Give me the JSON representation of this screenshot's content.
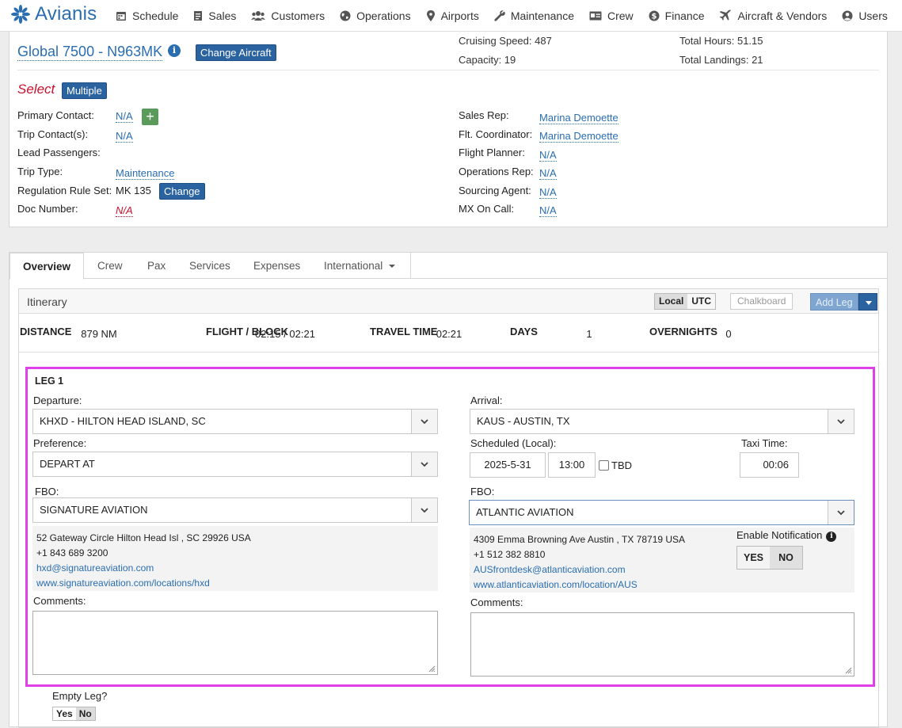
{
  "nav": {
    "logo": "Avianis",
    "items": [
      {
        "label": "Schedule",
        "icon": "calendar-icon"
      },
      {
        "label": "Sales",
        "icon": "receipt-icon"
      },
      {
        "label": "Customers",
        "icon": "users-icon"
      },
      {
        "label": "Operations",
        "icon": "globe-icon"
      },
      {
        "label": "Airports",
        "icon": "map-pin-icon"
      },
      {
        "label": "Maintenance",
        "icon": "wrench-icon"
      },
      {
        "label": "Crew",
        "icon": "id-card-icon"
      },
      {
        "label": "Finance",
        "icon": "dollar-icon"
      },
      {
        "label": "Aircraft & Vendors",
        "icon": "plane-icon"
      },
      {
        "label": "Users",
        "icon": "user-icon"
      }
    ]
  },
  "header": {
    "aircraft": "Global 7500 - N963MK",
    "change_aircraft": "Change Aircraft",
    "cruising_speed": "Cruising Speed: 487",
    "capacity": "Capacity: 19",
    "total_hours": "Total Hours: 51.15",
    "total_landings": "Total Landings: 21",
    "select_label": "Select",
    "multiple": "Multiple",
    "left_fields": [
      {
        "label": "Primary Contact:",
        "value": "N/A"
      },
      {
        "label": "Trip Contact(s):",
        "value": "N/A"
      },
      {
        "label": "Lead Passengers:",
        "value": ""
      },
      {
        "label": "Trip Type:",
        "value": "Maintenance"
      },
      {
        "label": "Regulation Rule Set:",
        "value": "MK 135"
      },
      {
        "label": "Doc Number:",
        "value": "N/A"
      }
    ],
    "change_rule": "Change",
    "right_fields": [
      {
        "label": "Sales Rep:",
        "value": "Marina Demoette"
      },
      {
        "label": "Flt. Coordinator:",
        "value": "Marina Demoette"
      },
      {
        "label": "Flight Planner:",
        "value": "N/A"
      },
      {
        "label": "Operations Rep:",
        "value": "N/A"
      },
      {
        "label": "Sourcing Agent:",
        "value": "N/A"
      },
      {
        "label": "MX On Call:",
        "value": "N/A"
      }
    ]
  },
  "tabs": [
    "Overview",
    "Crew",
    "Pax",
    "Services",
    "Expenses",
    "International"
  ],
  "itinerary": {
    "title": "Itinerary",
    "local": "Local",
    "utc": "UTC",
    "chalkboard": "Chalkboard",
    "add_leg": "Add Leg",
    "stats": [
      {
        "label": "DISTANCE",
        "value": "879 NM"
      },
      {
        "label": "FLIGHT / BLOCK",
        "value": "02:15 / 02:21"
      },
      {
        "label": "TRAVEL TIME",
        "value": "02:21"
      },
      {
        "label": "DAYS",
        "value": "1"
      },
      {
        "label": "OVERNIGHTS",
        "value": "0"
      }
    ]
  },
  "leg": {
    "title": "LEG 1",
    "departure_label": "Departure:",
    "departure": "KHXD - HILTON HEAD ISLAND, SC",
    "preference_label": "Preference:",
    "preference": "DEPART AT",
    "fbo_label": "FBO:",
    "dep_fbo": "SIGNATURE AVIATION",
    "dep_address": "52 Gateway Circle  Hilton Head Isl , SC  29926  USA",
    "dep_phone": "+1 843 689 3200",
    "dep_email": "hxd@signatureaviation.com",
    "dep_web": "www.signatureaviation.com/locations/hxd",
    "comments_label": "Comments:",
    "arrival_label": "Arrival:",
    "arrival": "KAUS - AUSTIN, TX",
    "scheduled_label": "Scheduled (Local):",
    "date": "2025-5-31",
    "time": "13:00",
    "tbd": "TBD",
    "taxi_label": "Taxi Time:",
    "taxi": "00:06",
    "arr_fbo": "ATLANTIC AVIATION",
    "arr_address": "4309 Emma Browning Ave  Austin , TX  78719  USA",
    "arr_phone": "+1 512 382 8810",
    "arr_email": "AUSfrontdesk@atlanticaviation.com",
    "arr_web": "www.atlanticaviation.com/location/AUS",
    "notification_label": "Enable Notification",
    "yes": "YES",
    "no": "NO"
  },
  "empty_leg": {
    "label": "Empty Leg?",
    "yes": "Yes",
    "no": "No"
  }
}
